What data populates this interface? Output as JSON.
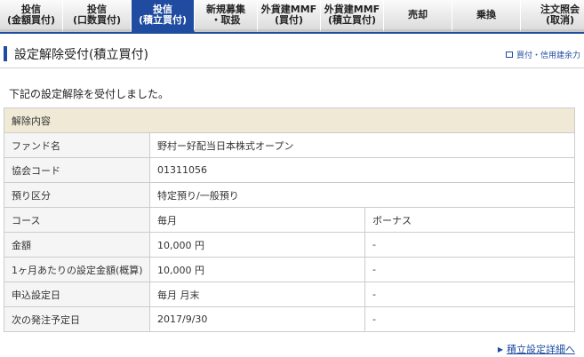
{
  "tabs": [
    {
      "line1": "投信",
      "line2": "(金額買付)",
      "active": false
    },
    {
      "line1": "投信",
      "line2": "(口数買付)",
      "active": false
    },
    {
      "line1": "投信",
      "line2": "(積立買付)",
      "active": true
    },
    {
      "line1": "新規募集",
      "line2": "・取扱",
      "active": false
    },
    {
      "line1": "外貨建MMF",
      "line2": "(買付)",
      "active": false
    },
    {
      "line1": "外貨建MMF",
      "line2": "(積立買付)",
      "active": false
    },
    {
      "line1": "売却",
      "line2": "",
      "active": false
    },
    {
      "line1": "乗換",
      "line2": "",
      "active": false
    },
    {
      "line1": "注文照会",
      "line2": "(取消)",
      "active": false
    }
  ],
  "header": {
    "title": "設定解除受付(積立買付)",
    "link": "買付・信用建余力"
  },
  "message": "下記の設定解除を受付しました。",
  "table": {
    "section_header": "解除内容",
    "rows": [
      {
        "label": "ファンド名",
        "value": "野村ー好配当日本株式オープン"
      },
      {
        "label": "協会コード",
        "value": "01311056"
      },
      {
        "label": "預り区分",
        "value": "特定預り/一般預り"
      },
      {
        "label": "コース",
        "value": "毎月",
        "value2": "ボーナス"
      },
      {
        "label": "金額",
        "value": "10,000 円",
        "value2": "-"
      },
      {
        "label": "1ヶ月あたりの設定金額(概算)",
        "value": "10,000 円",
        "value2": "-"
      },
      {
        "label": "申込設定日",
        "value": "毎月 月末",
        "value2": "-"
      },
      {
        "label": "次の発注予定日",
        "value": "2017/9/30",
        "value2": "-"
      }
    ]
  },
  "footer_link": "積立設定詳細へ",
  "colors": {
    "accent": "#1f4ba0",
    "header_bg": "#efe9d6"
  }
}
